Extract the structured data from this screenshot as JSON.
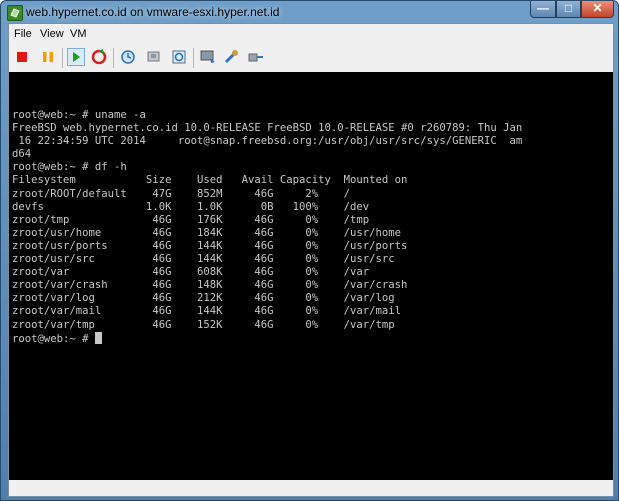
{
  "window": {
    "title": "web.hypernet.co.id on vmware-esxi.hyper.net.id"
  },
  "menu": {
    "items": [
      "File",
      "View",
      "VM"
    ]
  },
  "toolbar": {
    "icons": [
      "stop-icon",
      "pause-icon",
      "play-icon",
      "reset-icon",
      "snapshot-icon",
      "snapshot-revert-icon",
      "snapshot-manager-icon",
      "console-icon",
      "settings-icon",
      "connect-device-icon"
    ],
    "colors": {
      "stop": "#e01818",
      "pause": "#f0a000",
      "play": "#1c9a1c",
      "reset": "#d02020"
    }
  },
  "console": {
    "lines": [
      "root@web:~ # uname -a",
      "FreeBSD web.hypernet.co.id 10.0-RELEASE FreeBSD 10.0-RELEASE #0 r260789: Thu Jan",
      " 16 22:34:59 UTC 2014     root@snap.freebsd.org:/usr/obj/usr/src/sys/GENERIC  am",
      "d64",
      "root@web:~ # df -h",
      "Filesystem           Size    Used   Avail Capacity  Mounted on",
      "zroot/ROOT/default    47G    852M     46G     2%    /",
      "devfs                1.0K    1.0K      0B   100%    /dev",
      "zroot/tmp             46G    176K     46G     0%    /tmp",
      "zroot/usr/home        46G    184K     46G     0%    /usr/home",
      "zroot/usr/ports       46G    144K     46G     0%    /usr/ports",
      "zroot/usr/src         46G    144K     46G     0%    /usr/src",
      "zroot/var             46G    608K     46G     0%    /var",
      "zroot/var/crash       46G    148K     46G     0%    /var/crash",
      "zroot/var/log         46G    212K     46G     0%    /var/log",
      "zroot/var/mail        46G    144K     46G     0%    /var/mail",
      "zroot/var/tmp         46G    152K     46G     0%    /var/tmp"
    ],
    "prompt": "root@web:~ # "
  }
}
